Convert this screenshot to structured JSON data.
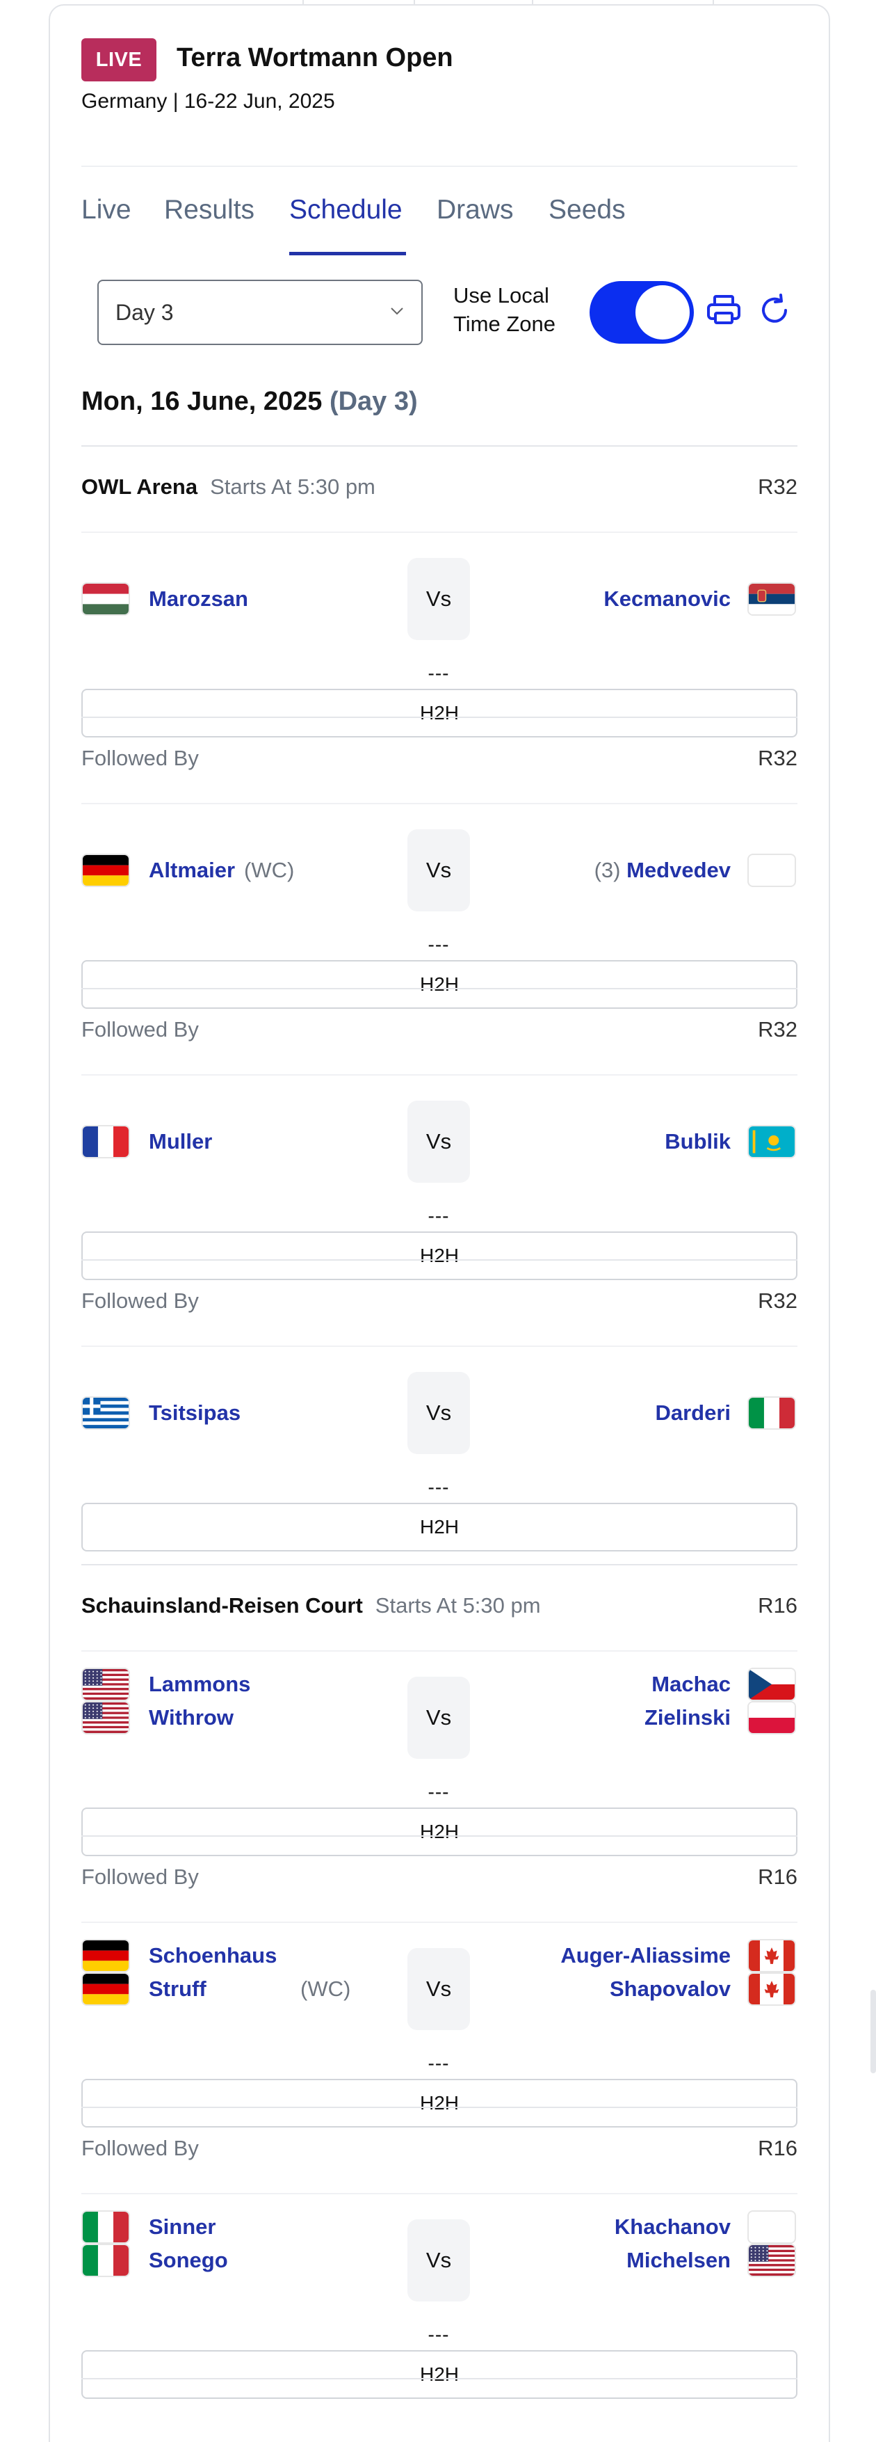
{
  "tournament": {
    "live_badge": "LIVE",
    "title": "Terra Wortmann Open",
    "subtitle": "Germany | 16-22 Jun, 2025"
  },
  "tabs": [
    "Live",
    "Results",
    "Schedule",
    "Draws",
    "Seeds"
  ],
  "active_tab": "Schedule",
  "controls": {
    "day_select_value": "Day 3",
    "local_tz_label_line1": "Use Local",
    "local_tz_label_line2": "Time Zone",
    "local_tz_enabled": true,
    "print_icon": "print-icon",
    "refresh_icon": "refresh-icon"
  },
  "date_header": {
    "date": "Mon, 16 June, 2025",
    "day": "(Day 3)"
  },
  "labels": {
    "followed_by": "Followed By",
    "vs": "Vs",
    "h2h": "H2H",
    "score_placeholder": "---"
  },
  "courts": [
    {
      "name": "OWL Arena",
      "starts": "Starts At 5:30 pm",
      "matches": [
        {
          "round": "R32",
          "left": [
            {
              "name": "Marozsan",
              "flag": "hungary"
            }
          ],
          "left_meta": "",
          "right": [
            {
              "name": "Kecmanovic",
              "flag": "serbia"
            }
          ],
          "right_meta": ""
        },
        {
          "round": "R32",
          "left": [
            {
              "name": "Altmaier",
              "flag": "germany"
            }
          ],
          "left_meta": "(WC)",
          "right": [
            {
              "name": "Medvedev",
              "flag": "none"
            }
          ],
          "right_meta": "(3)"
        },
        {
          "round": "R32",
          "left": [
            {
              "name": "Muller",
              "flag": "france"
            }
          ],
          "left_meta": "",
          "right": [
            {
              "name": "Bublik",
              "flag": "kazakhstan"
            }
          ],
          "right_meta": ""
        },
        {
          "round": "R32",
          "left": [
            {
              "name": "Tsitsipas",
              "flag": "greece"
            }
          ],
          "left_meta": "",
          "right": [
            {
              "name": "Darderi",
              "flag": "italy"
            }
          ],
          "right_meta": ""
        }
      ]
    },
    {
      "name": "Schauinsland-Reisen Court",
      "starts": "Starts At 5:30 pm",
      "matches": [
        {
          "round": "R16",
          "left": [
            {
              "name": "Lammons",
              "flag": "usa"
            },
            {
              "name": "Withrow",
              "flag": "usa"
            }
          ],
          "left_meta": "",
          "right": [
            {
              "name": "Machac",
              "flag": "czech"
            },
            {
              "name": "Zielinski",
              "flag": "poland"
            }
          ],
          "right_meta": ""
        },
        {
          "round": "R16",
          "left": [
            {
              "name": "Schoenhaus",
              "flag": "germany"
            },
            {
              "name": "Struff",
              "flag": "germany"
            }
          ],
          "left_meta": "(WC)",
          "right": [
            {
              "name": "Auger-Aliassime",
              "flag": "canada"
            },
            {
              "name": "Shapovalov",
              "flag": "canada"
            }
          ],
          "right_meta": ""
        },
        {
          "round": "R16",
          "left": [
            {
              "name": "Sinner",
              "flag": "italy"
            },
            {
              "name": "Sonego",
              "flag": "italy"
            }
          ],
          "left_meta": "",
          "right": [
            {
              "name": "Khachanov",
              "flag": "none"
            },
            {
              "name": "Michelsen",
              "flag": "usa"
            }
          ],
          "right_meta": ""
        }
      ]
    }
  ],
  "colors": {
    "accent": "#2233a8",
    "live_badge": "#b82d5c",
    "toggle_on": "#0b2ef0",
    "muted_text": "#6e757f"
  }
}
